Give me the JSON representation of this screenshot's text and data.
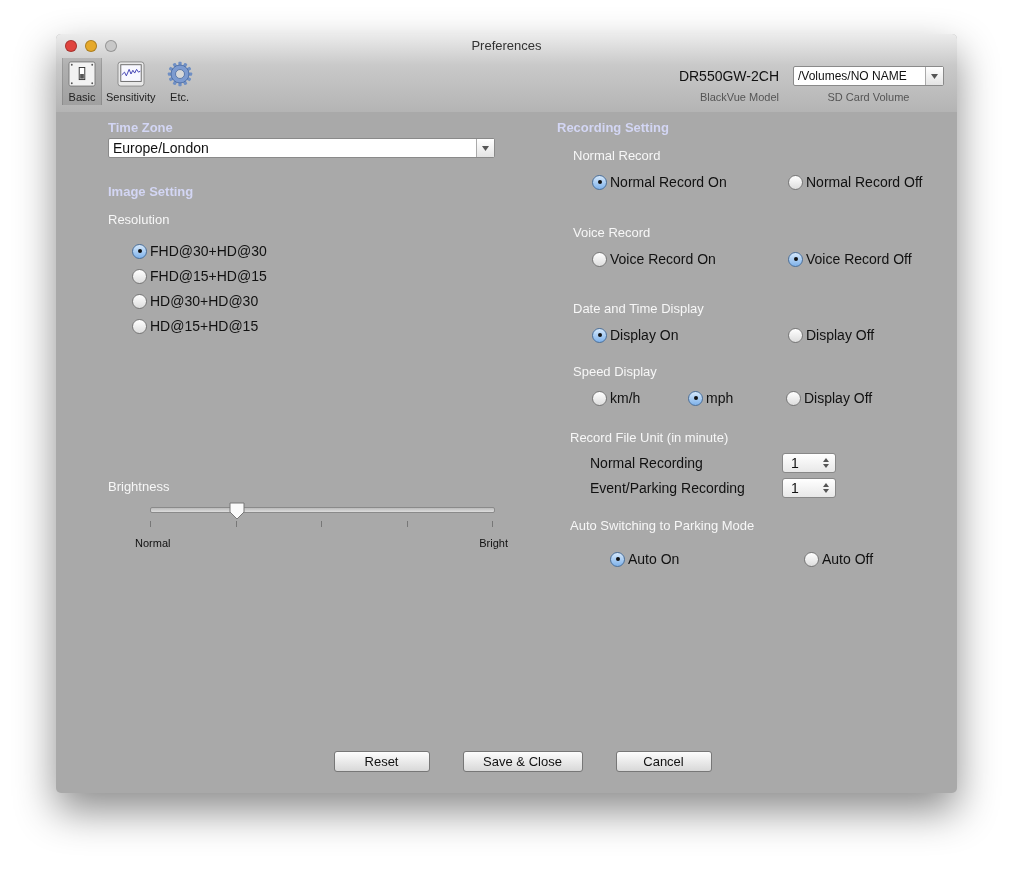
{
  "window": {
    "title": "Preferences"
  },
  "toolbar": {
    "tabs": [
      {
        "kind": "switch",
        "label": "Basic",
        "selected": true
      },
      {
        "kind": "graph",
        "label": "Sensitivity",
        "selected": false
      },
      {
        "kind": "gear",
        "label": "Etc.",
        "selected": false
      }
    ],
    "model": {
      "value": "DR550GW-2CH",
      "label": "BlackVue Model"
    },
    "sd_card": {
      "value": "/Volumes/NO NAME",
      "label": "SD Card Volume"
    }
  },
  "time_zone": {
    "title": "Time Zone",
    "value": "Europe/London"
  },
  "image_setting": {
    "title": "Image Setting",
    "resolution": {
      "label": "Resolution",
      "options": [
        {
          "label": "FHD@30+HD@30",
          "selected": true
        },
        {
          "label": "FHD@15+HD@15",
          "selected": false
        },
        {
          "label": "HD@30+HD@30",
          "selected": false
        },
        {
          "label": "HD@15+HD@15",
          "selected": false
        }
      ]
    },
    "brightness": {
      "label": "Brightness",
      "level": 0.25,
      "min_label": "Normal",
      "max_label": "Bright"
    }
  },
  "recording_setting": {
    "title": "Recording Setting",
    "groups": [
      {
        "label": "Normal Record",
        "options": [
          {
            "label": "Normal Record On",
            "selected": true
          },
          {
            "label": "Normal Record Off",
            "selected": false
          }
        ]
      },
      {
        "label": "Voice Record",
        "options": [
          {
            "label": "Voice Record On",
            "selected": false
          },
          {
            "label": "Voice Record Off",
            "selected": true
          }
        ]
      },
      {
        "label": "Date and Time Display",
        "options": [
          {
            "label": "Display On",
            "selected": true
          },
          {
            "label": "Display Off",
            "selected": false
          }
        ]
      },
      {
        "label": "Speed Display",
        "options": [
          {
            "label": "km/h",
            "selected": false
          },
          {
            "label": "mph",
            "selected": true
          },
          {
            "label": "Display Off",
            "selected": false
          }
        ]
      }
    ],
    "record_file_unit": {
      "label": "Record File Unit (in minute)",
      "fields": [
        {
          "label": "Normal Recording",
          "value": "1"
        },
        {
          "label": "Event/Parking Recording",
          "value": "1"
        }
      ]
    },
    "auto_switching": {
      "label": "Auto Switching to Parking Mode",
      "options": [
        {
          "label": "Auto On",
          "selected": true
        },
        {
          "label": "Auto Off",
          "selected": false
        }
      ]
    }
  },
  "buttons": [
    {
      "label": "Reset"
    },
    {
      "label": "Save & Close"
    },
    {
      "label": "Cancel"
    }
  ]
}
